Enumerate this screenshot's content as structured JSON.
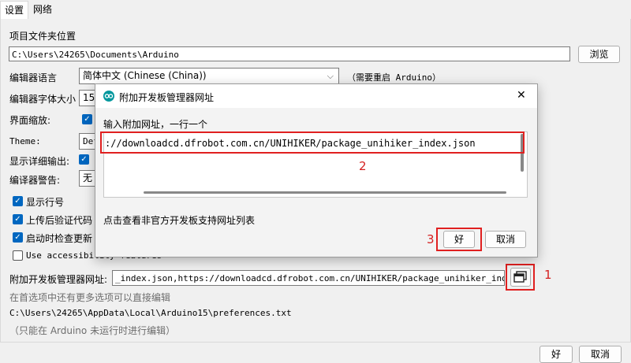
{
  "tabs": [
    {
      "label": "设置"
    },
    {
      "label": "网络"
    }
  ],
  "settings": {
    "sketchbook_label": "项目文件夹位置",
    "sketchbook_path": "C:\\Users\\24265\\Documents\\Arduino",
    "browse_label": "浏览",
    "editor_lang_label": "编辑器语言",
    "editor_lang_value": "简体中文 (Chinese (China))",
    "restart_note": "（需要重启 Arduino）",
    "font_size_label": "编辑器字体大小",
    "font_size_value": "15",
    "zoom_label": "界面缩放:",
    "theme_label": "Theme:",
    "theme_value": "Def",
    "verbose_label": "显示详细输出:",
    "warnings_label": "编译器警告:",
    "warnings_value": "无",
    "show_line_numbers": "显示行号",
    "verify_after_upload": "上传后验证代码",
    "check_updates": "启动时检查更新",
    "accessibility": "Use accessibility features",
    "board_urls_label": "附加开发板管理器网址:",
    "board_urls_value": "_index.json,https://downloadcd.dfrobot.com.cn/UNIHIKER/package_unihiker_index.json",
    "more_prefs_note": "在首选项中还有更多选项可以直接编辑",
    "prefs_path": "C:\\Users\\24265\\AppData\\Local\\Arduino15\\preferences.txt",
    "edit_note": "（只能在 Arduino 未运行时进行编辑）"
  },
  "footer": {
    "ok_label": "好",
    "cancel_label": "取消"
  },
  "dialog": {
    "title": "附加开发板管理器网址",
    "close_glyph": "✕",
    "prompt": "输入附加网址，一行一个",
    "url_line": "://downloadcd.dfrobot.com.cn/UNIHIKER/package_unihiker_index.json",
    "link_text": "点击查看非官方开发板支持网址列表",
    "ok_label": "好",
    "cancel_label": "取消"
  },
  "annotations": {
    "step1": "1",
    "step2": "2",
    "step3": "3"
  },
  "colors": {
    "highlight": "#e02020",
    "accent": "#0067c0",
    "arduino": "#00979d"
  }
}
